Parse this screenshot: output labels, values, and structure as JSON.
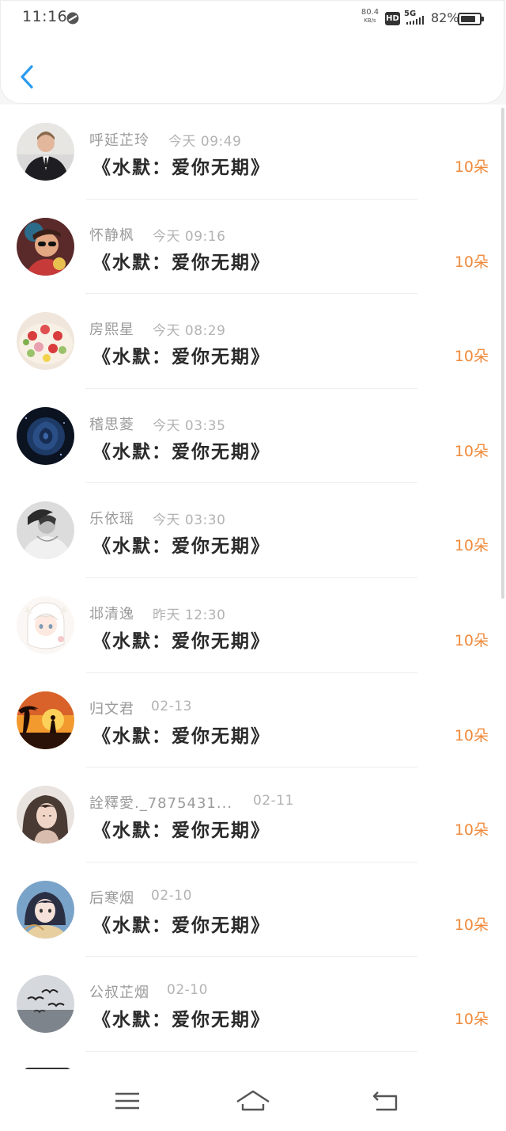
{
  "status_bar": {
    "time": "11:16",
    "net_rate": "80.4",
    "net_unit": "KB/s",
    "hd_label": "HD",
    "network": "5G",
    "battery_percent": "82%",
    "battery_level": 0.82
  },
  "colors": {
    "accent_blue": "#2a9bef",
    "amount_orange": "#f08a3c"
  },
  "items": [
    {
      "name": "呼延芷玲",
      "time": "今天 09:49",
      "title": "《水默：爱你无期》",
      "amount": "10朵",
      "avatar": "man-in-suit-avatar"
    },
    {
      "name": "怀静枫",
      "time": "今天 09:16",
      "title": "《水默：爱你无期》",
      "amount": "10朵",
      "avatar": "woman-sunglasses-avatar"
    },
    {
      "name": "房熙星",
      "time": "今天 08:29",
      "title": "《水默：爱你无期》",
      "amount": "10朵",
      "avatar": "flower-cake-avatar"
    },
    {
      "name": "稽思菱",
      "time": "今天 03:35",
      "title": "《水默：爱你无期》",
      "amount": "10朵",
      "avatar": "dark-rose-avatar"
    },
    {
      "name": "乐依瑶",
      "time": "今天 03:30",
      "title": "《水默：爱你无期》",
      "amount": "10朵",
      "avatar": "bw-woman-avatar"
    },
    {
      "name": "邶清逸",
      "time": "昨天 12:30",
      "title": "《水默：爱你无期》",
      "amount": "10朵",
      "avatar": "anime-girl-avatar"
    },
    {
      "name": "归文君",
      "time": "02-13",
      "title": "《水默：爱你无期》",
      "amount": "10朵",
      "avatar": "sunset-silhouette-avatar"
    },
    {
      "name": "詮釋愛._7875431...",
      "time": "02-11",
      "title": "《水默：爱你无期》",
      "amount": "10朵",
      "avatar": "woman-portrait-avatar"
    },
    {
      "name": "后寒烟",
      "time": "02-10",
      "title": "《水默：爱你无期》",
      "amount": "10朵",
      "avatar": "girl-blue-avatar"
    },
    {
      "name": "公叔芷烟",
      "time": "02-10",
      "title": "《水默：爱你无期》",
      "amount": "10朵",
      "avatar": "birds-sky-avatar"
    }
  ],
  "nav": {
    "menu_icon": "menu-icon",
    "home_icon": "home-icon",
    "back_icon": "back-return-icon"
  }
}
